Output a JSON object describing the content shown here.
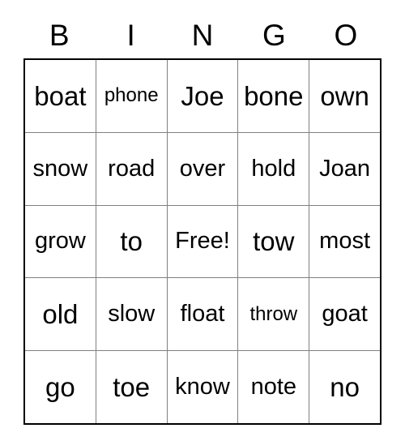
{
  "card": {
    "title": "BINGO",
    "headers": [
      "B",
      "I",
      "N",
      "G",
      "O"
    ],
    "colors": {
      "grid_line": "#808080",
      "border": "#000000",
      "text": "#000000",
      "background": "#ffffff"
    },
    "rows": [
      [
        {
          "text": "boat",
          "size": "lg"
        },
        {
          "text": "phone",
          "size": "sm"
        },
        {
          "text": "Joe",
          "size": "lg"
        },
        {
          "text": "bone",
          "size": "lg"
        },
        {
          "text": "own",
          "size": "lg"
        }
      ],
      [
        {
          "text": "snow",
          "size": "md"
        },
        {
          "text": "road",
          "size": "md"
        },
        {
          "text": "over",
          "size": "md"
        },
        {
          "text": "hold",
          "size": "md"
        },
        {
          "text": "Joan",
          "size": "md"
        }
      ],
      [
        {
          "text": "grow",
          "size": "md"
        },
        {
          "text": "to",
          "size": "lg"
        },
        {
          "text": "Free!",
          "size": "md"
        },
        {
          "text": "tow",
          "size": "lg"
        },
        {
          "text": "most",
          "size": "md"
        }
      ],
      [
        {
          "text": "old",
          "size": "lg"
        },
        {
          "text": "slow",
          "size": "md"
        },
        {
          "text": "float",
          "size": "md"
        },
        {
          "text": "throw",
          "size": "sm"
        },
        {
          "text": "goat",
          "size": "md"
        }
      ],
      [
        {
          "text": "go",
          "size": "lg"
        },
        {
          "text": "toe",
          "size": "lg"
        },
        {
          "text": "know",
          "size": "md"
        },
        {
          "text": "note",
          "size": "md"
        },
        {
          "text": "no",
          "size": "lg"
        }
      ]
    ]
  }
}
